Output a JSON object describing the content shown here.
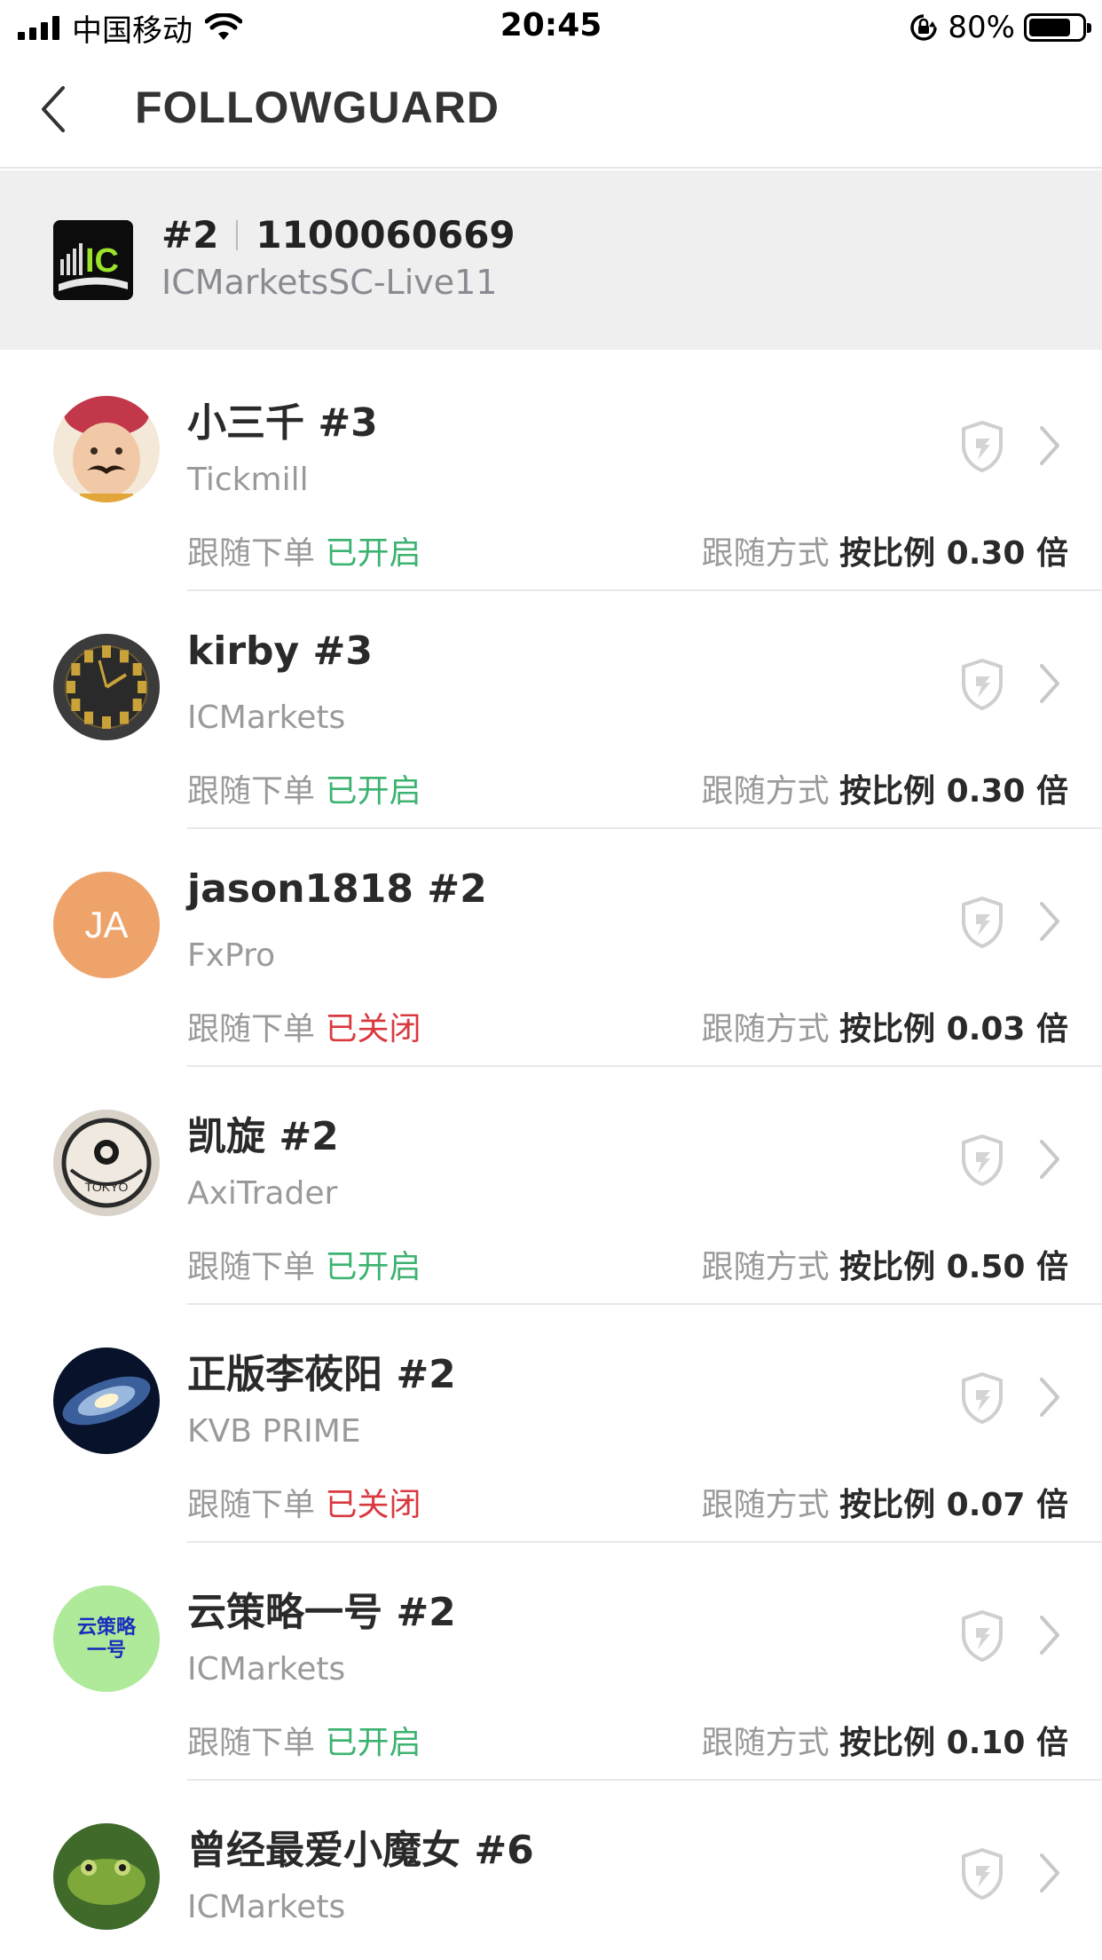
{
  "status_bar": {
    "carrier": "中国移动",
    "time": "20:45",
    "battery": "80%",
    "battery_level": 0.8
  },
  "nav": {
    "title": "FOLLOWGUARD"
  },
  "account": {
    "index": "#2",
    "number": "1100060669",
    "server": "ICMarketsSC-Live11",
    "logo_text": "IC"
  },
  "labels": {
    "follow_order": "跟随下单",
    "follow_mode": "跟随方式"
  },
  "followers": [
    {
      "name": "小三千 #3",
      "broker": "Tickmill",
      "status": "已开启",
      "enabled": true,
      "mode": "按比例 0.30 倍",
      "avatar": "baby-photo"
    },
    {
      "name": "kirby #3",
      "broker": "ICMarkets",
      "status": "已开启",
      "enabled": true,
      "mode": "按比例 0.30 倍",
      "avatar": "clock-photo"
    },
    {
      "name": "jason1818 #2",
      "broker": "FxPro",
      "status": "已关闭",
      "enabled": false,
      "mode": "按比例 0.03 倍",
      "avatar": "initials",
      "initials": "JA"
    },
    {
      "name": "凯旋 #2",
      "broker": "AxiTrader",
      "status": "已开启",
      "enabled": true,
      "mode": "按比例 0.50 倍",
      "avatar": "tokyo-badge",
      "badge_text": "TOKYO"
    },
    {
      "name": "正版李莜阳 #2",
      "broker": "KVB PRIME",
      "status": "已关闭",
      "enabled": false,
      "mode": "按比例 0.07 倍",
      "avatar": "galaxy-photo"
    },
    {
      "name": "云策略一号 #2",
      "broker": "ICMarkets",
      "status": "已开启",
      "enabled": true,
      "mode": "按比例 0.10 倍",
      "avatar": "text-badge",
      "badge_line1": "云策略",
      "badge_line2": "一号"
    },
    {
      "name": "曾经最爱小魔女 #6",
      "broker": "ICMarkets",
      "status": "",
      "enabled": true,
      "mode": "",
      "avatar": "frog-photo"
    }
  ],
  "colors": {
    "enabled": "#3cb371",
    "disabled": "#d9393f",
    "header_bg": "#efefef"
  }
}
